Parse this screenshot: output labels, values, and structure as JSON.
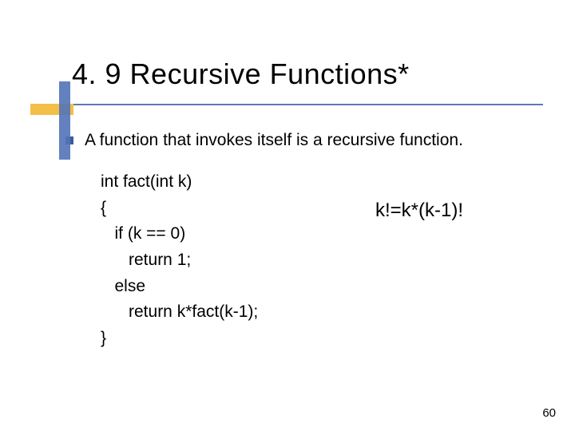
{
  "title": "4. 9 Recursive Functions*",
  "bullet": "A function that invokes itself is a recursive function.",
  "code": {
    "l1": "int fact(int k)",
    "l2": "{",
    "l3": "   if (k == 0)",
    "l4": "      return 1;",
    "l5": "   else",
    "l6": "      return k*fact(k-1);",
    "l7": "}"
  },
  "formula": "k!=k*(k-1)!",
  "page_number": "60"
}
